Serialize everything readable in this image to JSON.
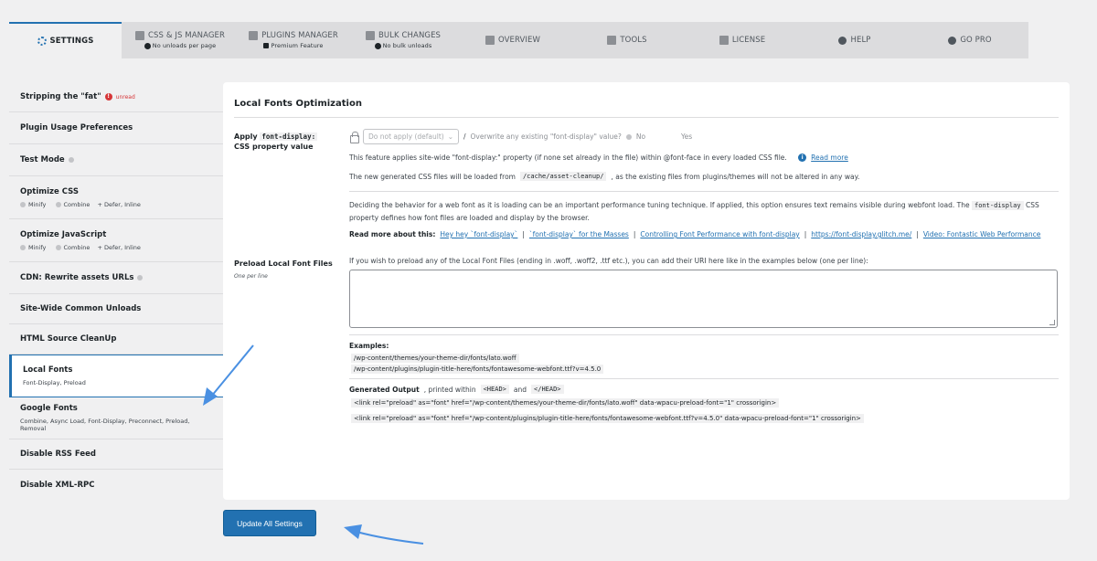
{
  "tabs": [
    {
      "label": "SETTINGS",
      "sub": "",
      "icon": "gear-icon",
      "active": true
    },
    {
      "label": "CSS & JS MANAGER",
      "sub": "No unloads per page",
      "icon": "file-code-icon"
    },
    {
      "label": "PLUGINS MANAGER",
      "sub": "Premium Feature",
      "icon": "plug-icon"
    },
    {
      "label": "BULK CHANGES",
      "sub": "No bulk unloads",
      "icon": "boxes-icon"
    },
    {
      "label": "OVERVIEW",
      "sub": "",
      "icon": "document-icon"
    },
    {
      "label": "TOOLS",
      "sub": "",
      "icon": "wrench-icon"
    },
    {
      "label": "LICENSE",
      "sub": "",
      "icon": "license-icon"
    },
    {
      "label": "HELP",
      "sub": "",
      "icon": "lifebuoy-icon"
    },
    {
      "label": "GO PRO",
      "sub": "",
      "icon": "star-icon"
    }
  ],
  "sidebar": {
    "items": [
      {
        "title": "Stripping the \"fat\"",
        "badge": "unread"
      },
      {
        "title": "Plugin Usage Preferences"
      },
      {
        "title": "Test Mode"
      },
      {
        "title": "Optimize CSS",
        "sub1": "Minify",
        "sub2": "Combine",
        "sub3": "+ Defer, Inline"
      },
      {
        "title": "Optimize JavaScript",
        "sub1": "Minify",
        "sub2": "Combine",
        "sub3": "+ Defer, Inline"
      },
      {
        "title": "CDN: Rewrite assets URLs"
      },
      {
        "title": "Site-Wide Common Unloads"
      },
      {
        "title": "HTML Source CleanUp"
      },
      {
        "title": "Local Fonts",
        "sub": "Font-Display, Preload"
      },
      {
        "title": "Google Fonts",
        "sub": "Combine, Async Load, Font-Display, Preconnect, Preload, Removal"
      },
      {
        "title": "Disable RSS Feed"
      },
      {
        "title": "Disable XML-RPC"
      }
    ]
  },
  "panel": {
    "title": "Local Fonts Optimization",
    "fd_label_pre": "Apply",
    "fd_label_code": "font-display:",
    "fd_label_post": "CSS property value",
    "select_value": "Do not apply (default)",
    "slash": "/",
    "overwrite_q": "Overwrite any existing \"font-display\" value?",
    "opt_no": "No",
    "opt_yes": "Yes",
    "desc1": "This feature applies site-wide \"font-display:\" property (if none set already in the file) within @font-face in every loaded CSS file.",
    "read_more": "Read more",
    "desc2_pre": "The new generated CSS files will be loaded from",
    "desc2_code": "/cache/asset-cleanup/",
    "desc2_post": ", as the existing files from plugins/themes will not be altered in any way.",
    "desc3_pre": "Deciding the behavior for a web font as it is loading can be an important performance tuning technique. If applied, this option ensures text remains visible during webfont load. The",
    "desc3_code": "font-display",
    "desc3_post": "CSS property defines how font files are loaded and display by the browser.",
    "read_more_about": "Read more about this:",
    "links": [
      "Hey hey `font-display`",
      "`font-display` for the Masses",
      "Controlling Font Performance with font-display",
      "https://font-display.glitch.me/",
      "Video: Fontastic Web Performance"
    ],
    "sep": "|",
    "preload_label": "Preload Local Font Files",
    "preload_note": "One per line",
    "preload_desc": "If you wish to preload any of the Local Font Files (ending in .woff, .woff2, .ttf etc.), you can add their URI here like in the examples below (one per line):",
    "textarea_value": "",
    "examples_label": "Examples:",
    "example1": "/wp-content/themes/your-theme-dir/fonts/lato.woff",
    "example2": "/wp-content/plugins/plugin-title-here/fonts/fontawesome-webfont.ttf?v=4.5.0",
    "gen_label": "Generated Output",
    "gen_pre": ", printed within",
    "gen_head": "<HEAD>",
    "gen_and": "and",
    "gen_head_close": "</HEAD>",
    "output1": "<link rel=\"preload\" as=\"font\" href=\"/wp-content/themes/your-theme-dir/fonts/lato.woff\" data-wpacu-preload-font=\"1\" crossorigin>",
    "output2": "<link rel=\"preload\" as=\"font\" href=\"/wp-content/plugins/plugin-title-here/fonts/fontawesome-webfont.ttf?v=4.5.0\" data-wpacu-preload-font=\"1\" crossorigin>"
  },
  "update_button": "Update All Settings",
  "colors": {
    "accent": "#2271b1",
    "arrow": "#4a90e2",
    "unread": "#d63638"
  }
}
